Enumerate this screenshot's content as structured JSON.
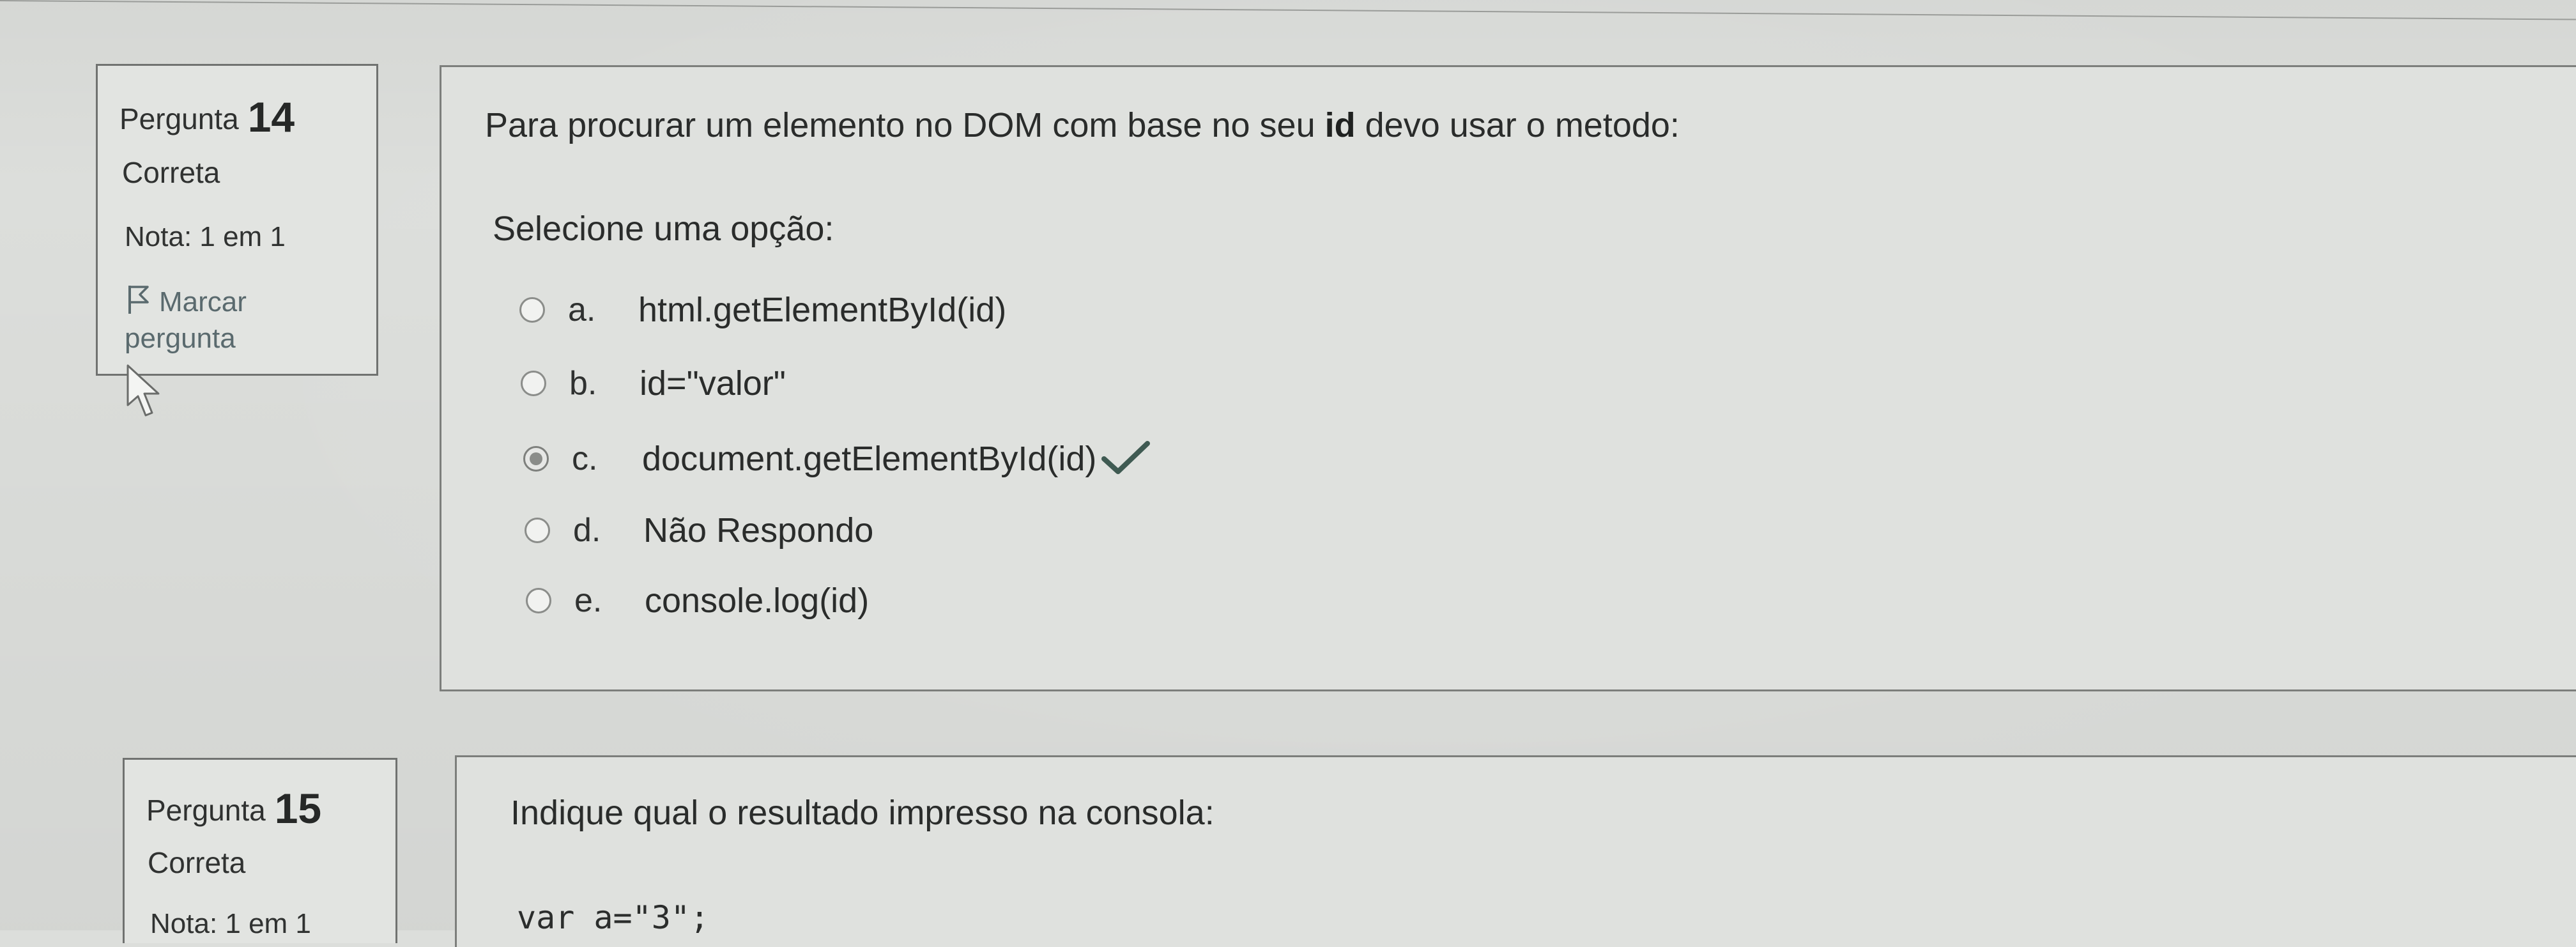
{
  "questions": [
    {
      "label": "Pergunta",
      "number": "14",
      "state": "Correta",
      "grade": "Nota: 1 em 1",
      "flag_line1": "Marcar",
      "flag_line2": "pergunta",
      "text_before": "Para procurar um elemento no DOM com base no seu ",
      "text_bold": "id",
      "text_after": " devo usar o metodo:",
      "prompt": "Selecione uma opção:",
      "options": [
        {
          "letter": "a.",
          "text": "html.getElementById(id)",
          "selected": false
        },
        {
          "letter": "b.",
          "text": "id=\"valor\"",
          "selected": false
        },
        {
          "letter": "c.",
          "text": "document.getElementById(id)",
          "selected": true,
          "correct": true
        },
        {
          "letter": "d.",
          "text": "Não Respondo",
          "selected": false
        },
        {
          "letter": "e.",
          "text": "console.log(id)",
          "selected": false
        }
      ]
    },
    {
      "label": "Pergunta",
      "number": "15",
      "state": "Correta",
      "grade": "Nota: 1 em 1",
      "text": "Indique qual o resultado impresso na consola:",
      "code_line1": "var a=\"3\";"
    }
  ],
  "icons": {
    "flag": "flag-icon",
    "correct": "check-icon",
    "cursor": "mouse-pointer-icon"
  },
  "colors": {
    "check": "#3f5a52",
    "background": "#dcdedb",
    "border": "#707270"
  }
}
